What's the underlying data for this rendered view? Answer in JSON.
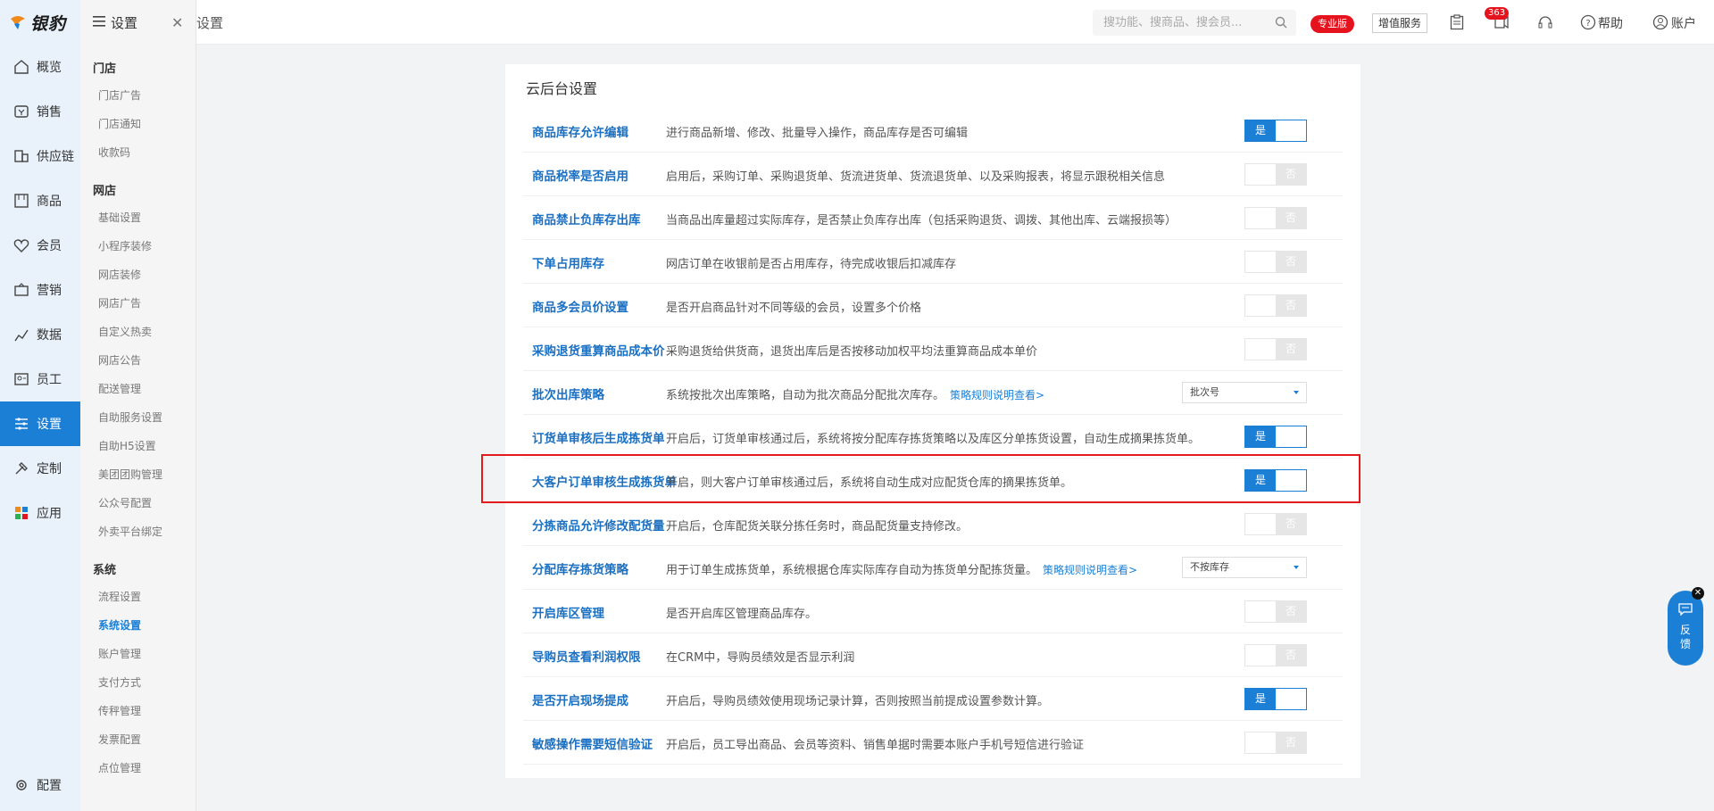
{
  "brand": {
    "name": "银豹"
  },
  "left_nav": {
    "items": [
      {
        "label": "概览",
        "icon": "home-icon"
      },
      {
        "label": "销售",
        "icon": "sales-icon"
      },
      {
        "label": "供应链",
        "icon": "supply-icon"
      },
      {
        "label": "商品",
        "icon": "goods-icon"
      },
      {
        "label": "会员",
        "icon": "member-icon"
      },
      {
        "label": "营销",
        "icon": "marketing-icon"
      },
      {
        "label": "数据",
        "icon": "chart-icon"
      },
      {
        "label": "员工",
        "icon": "staff-icon"
      },
      {
        "label": "设置",
        "icon": "settings-icon",
        "active": true
      },
      {
        "label": "定制",
        "icon": "custom-icon"
      },
      {
        "label": "应用",
        "icon": "apps-icon"
      }
    ],
    "bottom": {
      "label": "配置"
    }
  },
  "sub_panel": {
    "title": "设置",
    "groups": [
      {
        "label": "门店",
        "items": [
          "门店广告",
          "门店通知",
          "收款码"
        ]
      },
      {
        "label": "网店",
        "items": [
          "基础设置",
          "小程序装修",
          "网店装修",
          "网店广告",
          "自定义热卖",
          "网店公告",
          "配送管理",
          "自助服务设置",
          "自助H5设置",
          "美团团购管理",
          "公众号配置",
          "外卖平台绑定"
        ]
      },
      {
        "label": "系统",
        "items": [
          "流程设置",
          "系统设置",
          "账户管理",
          "支付方式",
          "传秤管理",
          "发票配置",
          "点位管理"
        ]
      }
    ],
    "active_item": "系统设置"
  },
  "topbar": {
    "breadcrumb": "设置",
    "search_placeholder": "搜功能、搜商品、搜会员...",
    "pro_badge": "专业版",
    "vas_button": "增值服务",
    "message_count": "363",
    "help_label": "帮助",
    "account_label": "账户"
  },
  "card": {
    "title": "云后台设置",
    "rows": [
      {
        "name": "商品库存允许编辑",
        "desc": "进行商品新增、修改、批量导入操作，商品库存是否可编辑",
        "control": "toggle",
        "value": true
      },
      {
        "name": "商品税率是否启用",
        "desc": "启用后，采购订单、采购退货单、货流进货单、货流退货单、以及采购报表，将显示跟税相关信息",
        "control": "toggle",
        "value": false
      },
      {
        "name": "商品禁止负库存出库",
        "desc": "当商品出库量超过实际库存，是否禁止负库存出库（包括采购退货、调拨、其他出库、云端报损等）",
        "control": "toggle",
        "value": false
      },
      {
        "name": "下单占用库存",
        "desc": "网店订单在收银前是否占用库存，待完成收银后扣减库存",
        "control": "toggle",
        "value": false
      },
      {
        "name": "商品多会员价设置",
        "desc": "是否开启商品针对不同等级的会员，设置多个价格",
        "control": "toggle",
        "value": false
      },
      {
        "name": "采购退货重算商品成本价",
        "desc": "采购退货给供货商，退货出库后是否按移动加权平均法重算商品成本单价",
        "control": "toggle",
        "value": false
      },
      {
        "name": "批次出库策略",
        "desc": "系统按批次出库策略，自动为批次商品分配批次库存。",
        "link": "策略规则说明查看>",
        "control": "select",
        "select_value": "批次号"
      },
      {
        "name": "订货单审核后生成拣货单",
        "desc": "开启后，订货单审核通过后，系统将按分配库存拣货策略以及库区分单拣货设置，自动生成摘果拣货单。",
        "control": "toggle",
        "value": true
      },
      {
        "name": "大客户订单审核生成拣货单",
        "desc": "开启，则大客户订单审核通过后，系统将自动生成对应配货仓库的摘果拣货单。",
        "control": "toggle",
        "value": true
      },
      {
        "name": "分拣商品允许修改配货量",
        "desc": "开启后，仓库配货关联分拣任务时，商品配货量支持修改。",
        "control": "toggle",
        "value": false
      },
      {
        "name": "分配库存拣货策略",
        "desc": "用于订单生成拣货单，系统根据仓库实际库存自动为拣货单分配拣货量。",
        "link": "策略规则说明查看>",
        "control": "select",
        "select_value": "不按库存"
      },
      {
        "name": "开启库区管理",
        "desc": "是否开启库区管理商品库存。",
        "control": "toggle",
        "value": false
      },
      {
        "name": "导购员查看利润权限",
        "desc": "在CRM中，导购员绩效是否显示利润",
        "control": "toggle",
        "value": false
      },
      {
        "name": "是否开启现场提成",
        "desc": "开启后，导购员绩效使用现场记录计算，否则按照当前提成设置参数计算。",
        "control": "toggle",
        "value": true
      },
      {
        "name": "敏感操作需要短信验证",
        "desc": "开启后，员工导出商品、会员等资料、销售单据时需要本账户手机号短信进行验证",
        "control": "toggle",
        "value": false
      }
    ],
    "yes_label": "是",
    "no_label": "否"
  },
  "feedback": {
    "label": "反馈"
  },
  "colors": {
    "primary": "#1b7fd6",
    "highlight_border": "#e21b1b",
    "badge_red": "#e5131d"
  }
}
